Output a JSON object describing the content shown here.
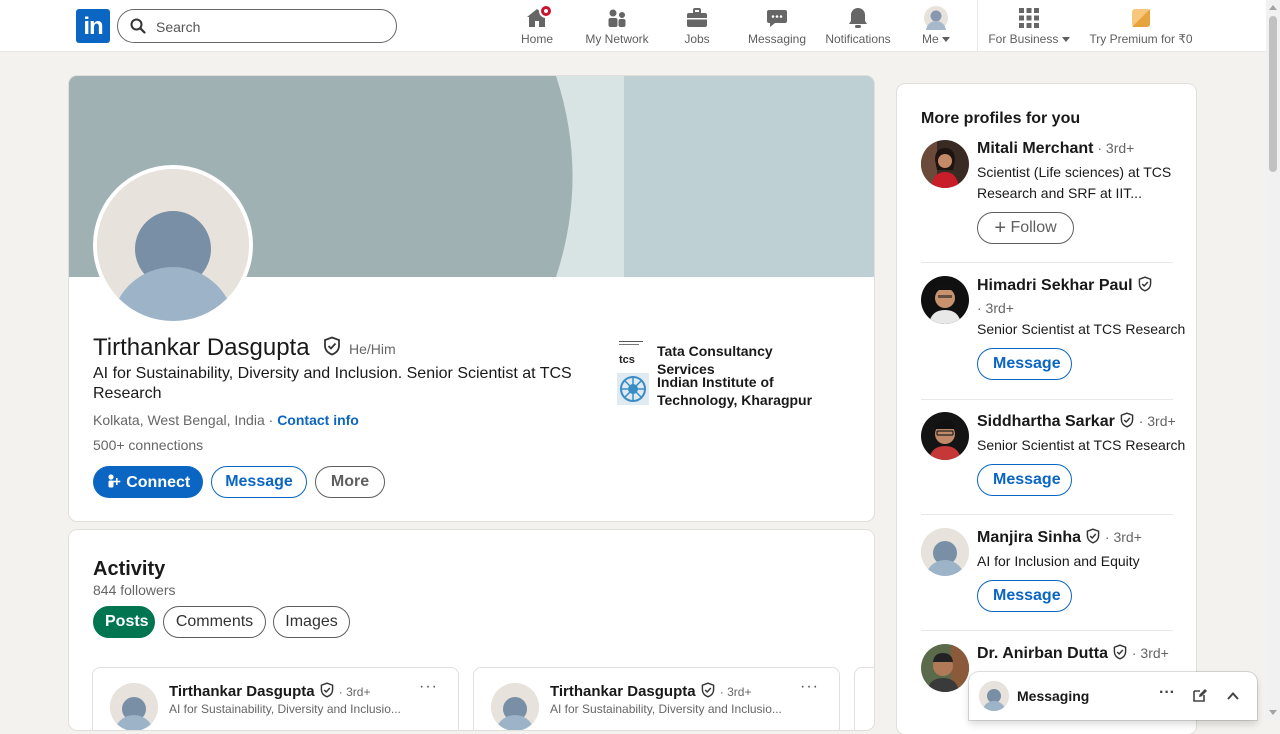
{
  "nav": {
    "logo": "in",
    "search_placeholder": "Search",
    "items": [
      {
        "label": "Home",
        "icon": "home-icon"
      },
      {
        "label": "My Network",
        "icon": "network-icon"
      },
      {
        "label": "Jobs",
        "icon": "briefcase-icon"
      },
      {
        "label": "Messaging",
        "icon": "chat-icon"
      },
      {
        "label": "Notifications",
        "icon": "bell-icon"
      },
      {
        "label": "Me",
        "icon": "avatar"
      },
      {
        "label": "For Business",
        "icon": "grid-icon"
      },
      {
        "label": "Try Premium for ₹0",
        "icon": "premium-icon"
      }
    ]
  },
  "profile": {
    "name": "Tirthankar Dasgupta",
    "pronouns": "He/Him",
    "headline": "AI for Sustainability, Diversity and Inclusion. Senior Scientist at TCS Research",
    "location": "Kolkata, West Bengal, India",
    "separator": " · ",
    "contact_info": "Contact info",
    "connections": "500+ connections",
    "buttons": {
      "connect": "Connect",
      "message": "Message",
      "more": "More"
    },
    "orgs": [
      {
        "name": "Tata Consultancy Services",
        "logo": "tcs-logo",
        "logo_text": "tcs"
      },
      {
        "name": "Indian Institute of Technology, Kharagpur",
        "logo": "iit-kgp-logo"
      }
    ]
  },
  "activity": {
    "title": "Activity",
    "followers": "844 followers",
    "tabs": [
      "Posts",
      "Comments",
      "Images"
    ],
    "active_tab": "Posts",
    "posts": [
      {
        "name": "Tirthankar Dasgupta",
        "degree": "· 3rd+",
        "headline": "AI for Sustainability, Diversity and Inclusio..."
      },
      {
        "name": "Tirthankar Dasgupta",
        "degree": "· 3rd+",
        "headline": "AI for Sustainability, Diversity and Inclusio..."
      }
    ]
  },
  "sidebar": {
    "title": "More profiles for you",
    "profiles": [
      {
        "name": "Mitali Merchant",
        "degree": " · 3rd+",
        "headline": "Scientist (Life sciences) at TCS Research and SRF at IIT...",
        "button": "Follow",
        "verified": false
      },
      {
        "name": "Himadri Sekhar Paul",
        "degree": "· 3rd+",
        "headline": "Senior Scientist at TCS Research",
        "button": "Message",
        "verified": true
      },
      {
        "name": "Siddhartha Sarkar",
        "degree": " · 3rd+",
        "headline": "Senior Scientist at TCS Research",
        "button": "Message",
        "verified": true
      },
      {
        "name": "Manjira Sinha",
        "degree": " · 3rd+",
        "headline": "AI for Inclusion and Equity",
        "button": "Message",
        "verified": true
      },
      {
        "name": "Dr. Anirban Dutta",
        "degree": " · 3rd+",
        "headline": "",
        "button": "",
        "verified": true
      }
    ]
  },
  "messaging": {
    "title": "Messaging",
    "dots": "···"
  },
  "colors": {
    "brand": "#0a66c2",
    "active_pill": "#01754f",
    "badge": "#cb112d",
    "cover": "#bed0d4"
  }
}
